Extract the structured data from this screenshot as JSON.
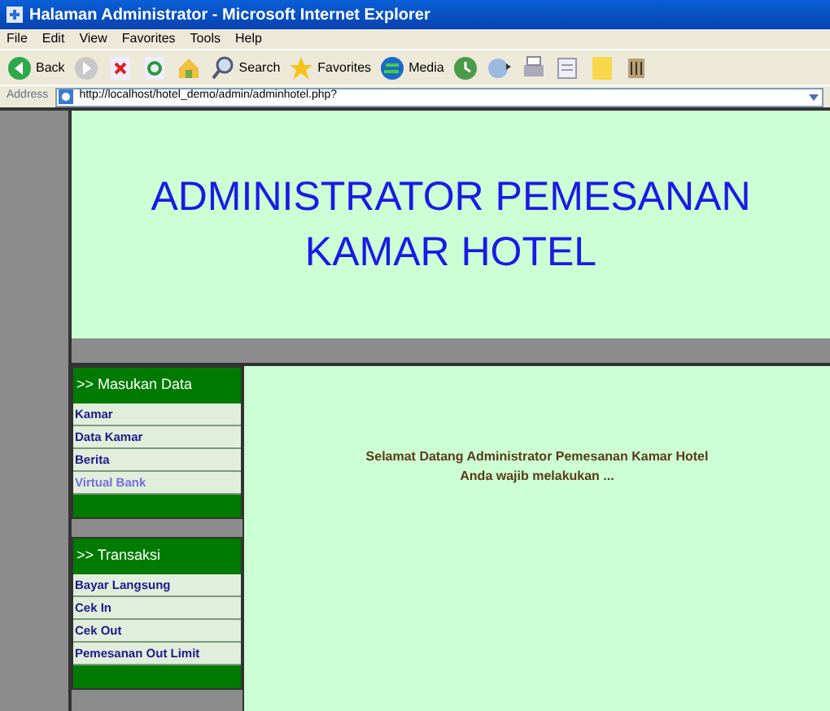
{
  "window": {
    "title": "Halaman Administrator - Microsoft Internet Explorer"
  },
  "menu": [
    "File",
    "Edit",
    "View",
    "Favorites",
    "Tools",
    "Help"
  ],
  "toolbar": [
    {
      "kind": "back",
      "label": "Back"
    },
    {
      "kind": "forward"
    },
    {
      "kind": "stop"
    },
    {
      "kind": "refresh"
    },
    {
      "kind": "home"
    },
    {
      "kind": "search",
      "label": "Search"
    },
    {
      "kind": "favorites",
      "label": "Favorites"
    },
    {
      "kind": "media",
      "label": "Media"
    },
    {
      "kind": "history"
    },
    {
      "kind": "mail"
    },
    {
      "kind": "print"
    },
    {
      "kind": "edit"
    },
    {
      "kind": "folder"
    },
    {
      "kind": "tools"
    }
  ],
  "address": {
    "label": "Address",
    "value": "http://localhost/hotel_demo/admin/adminhotel.php?"
  },
  "header": {
    "title_lines": [
      "ADMINISTRATOR PEMESANAN",
      "KAMAR HOTEL"
    ]
  },
  "sidebar": [
    {
      "heading": ">> Masukan Data",
      "items": [
        {
          "label": "Kamar",
          "visited": false
        },
        {
          "label": "Data Kamar",
          "visited": false
        },
        {
          "label": "Berita",
          "visited": false
        },
        {
          "label": "Virtual Bank",
          "visited": true
        }
      ]
    },
    {
      "heading": ">> Transaksi",
      "items": [
        {
          "label": "Bayar Langsung",
          "visited": false
        },
        {
          "label": "Cek In",
          "visited": false
        },
        {
          "label": "Cek Out",
          "visited": false
        },
        {
          "label": "Pemesanan Out Limit",
          "visited": false
        }
      ]
    }
  ],
  "main": {
    "lines": [
      "Selamat Datang Administrator Pemesanan Kamar Hotel",
      "Anda wajib melakukan ..."
    ]
  }
}
